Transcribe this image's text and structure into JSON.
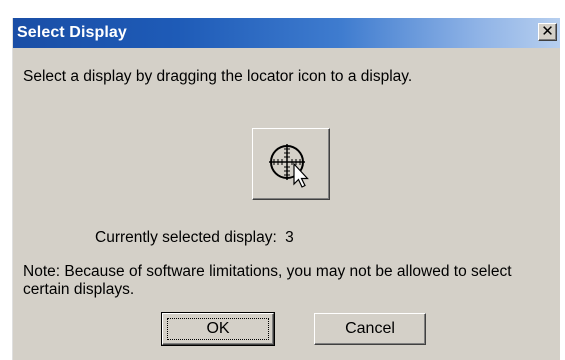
{
  "window": {
    "title": "Select Display",
    "close_glyph": "✕"
  },
  "instruction": "Select a display by dragging the locator icon to a display.",
  "locator": {
    "icon": "crosshair-target-with-cursor-icon"
  },
  "selected_display": {
    "label": "Currently selected display:",
    "value": "3"
  },
  "note": "Note: Because of software limitations, you may not be allowed to select certain displays.",
  "buttons": {
    "ok_label": "OK",
    "cancel_label": "Cancel"
  },
  "colors": {
    "title_bar_start": "#1a4ea6",
    "title_bar_end": "#b7cfef",
    "dialog_face": "#d4d0c8"
  }
}
